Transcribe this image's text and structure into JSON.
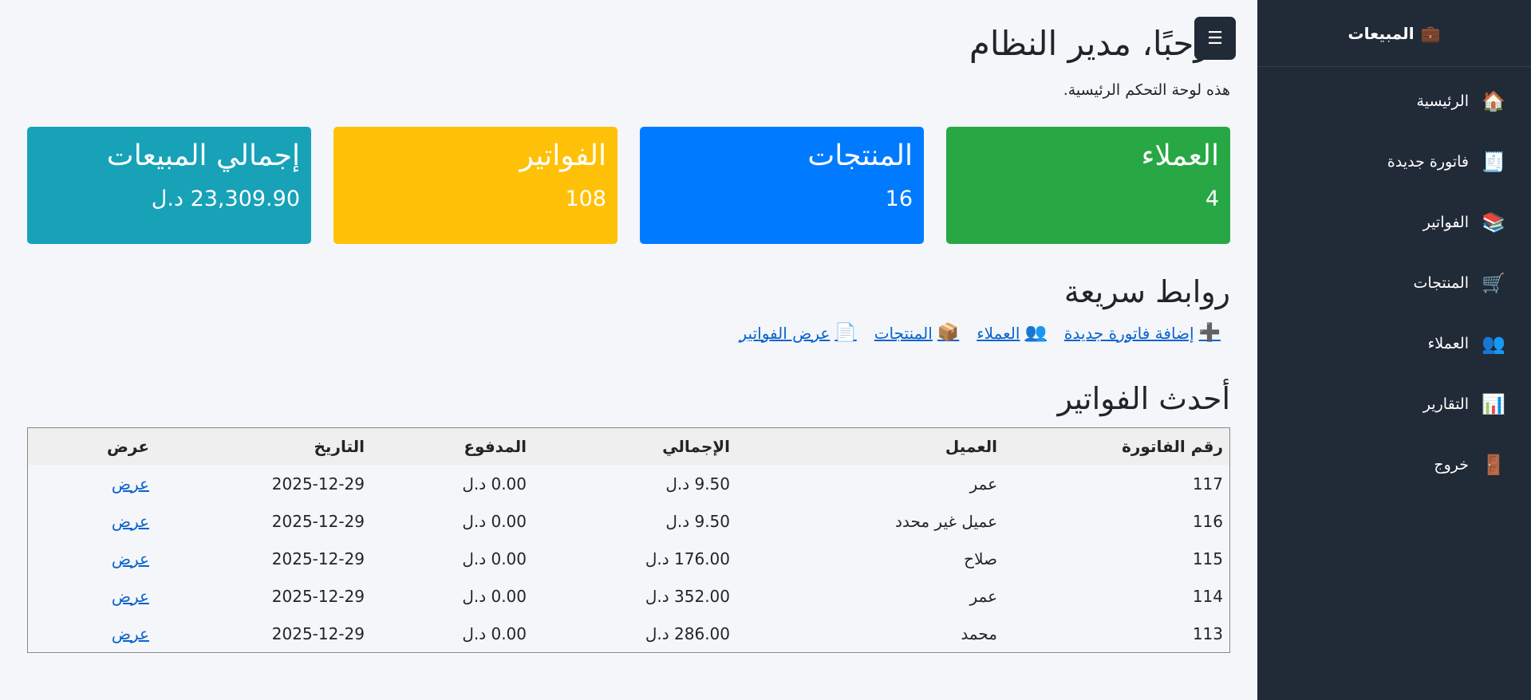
{
  "sidebar": {
    "brand_icon": "💼",
    "brand": "المبيعات",
    "items": [
      {
        "icon": "🏠",
        "label": "الرئيسية"
      },
      {
        "icon": "🧾",
        "label": "فاتورة جديدة"
      },
      {
        "icon": "📚",
        "label": "الفواتير"
      },
      {
        "icon": "🛒",
        "label": "المنتجات"
      },
      {
        "icon": "👥",
        "label": "العملاء"
      },
      {
        "icon": "📊",
        "label": "التقارير"
      },
      {
        "icon": "🚪",
        "label": "خروج"
      }
    ]
  },
  "header": {
    "menu_icon": "☰",
    "title": "مرحبًا، مدير النظام",
    "subtitle": "هذه لوحة التحكم الرئيسية."
  },
  "cards": [
    {
      "title": "العملاء",
      "value": "4",
      "color": "#28a745"
    },
    {
      "title": "المنتجات",
      "value": "16",
      "color": "#007bff"
    },
    {
      "title": "الفواتير",
      "value": "108",
      "color": "#ffc107"
    },
    {
      "title": "إجمالي المبيعات",
      "value": "23,309.90 د.ل",
      "color": "#17a2b8"
    }
  ],
  "quick_links": {
    "title": "روابط سريعة",
    "items": [
      {
        "icon": "➕",
        "label": "إضافة فاتورة جديدة"
      },
      {
        "icon": "👥",
        "label": "العملاء"
      },
      {
        "icon": "📦",
        "label": "المنتجات"
      },
      {
        "icon": "📄",
        "label": "عرض الفواتير"
      }
    ]
  },
  "invoices": {
    "title": "أحدث الفواتير",
    "headers": [
      "رقم الفاتورة",
      "العميل",
      "الإجمالي",
      "المدفوع",
      "التاريخ",
      "عرض"
    ],
    "rows": [
      [
        "117",
        "عمر",
        "9.50 د.ل",
        "0.00 د.ل",
        "2025-12-29",
        "عرض"
      ],
      [
        "116",
        "عميل غير محدد",
        "9.50 د.ل",
        "0.00 د.ل",
        "2025-12-29",
        "عرض"
      ],
      [
        "115",
        "صلاح",
        "176.00 د.ل",
        "0.00 د.ل",
        "2025-12-29",
        "عرض"
      ],
      [
        "114",
        "عمر",
        "352.00 د.ل",
        "0.00 د.ل",
        "2025-12-29",
        "عرض"
      ],
      [
        "113",
        "محمد",
        "286.00 د.ل",
        "0.00 د.ل",
        "2025-12-29",
        "عرض"
      ]
    ]
  }
}
